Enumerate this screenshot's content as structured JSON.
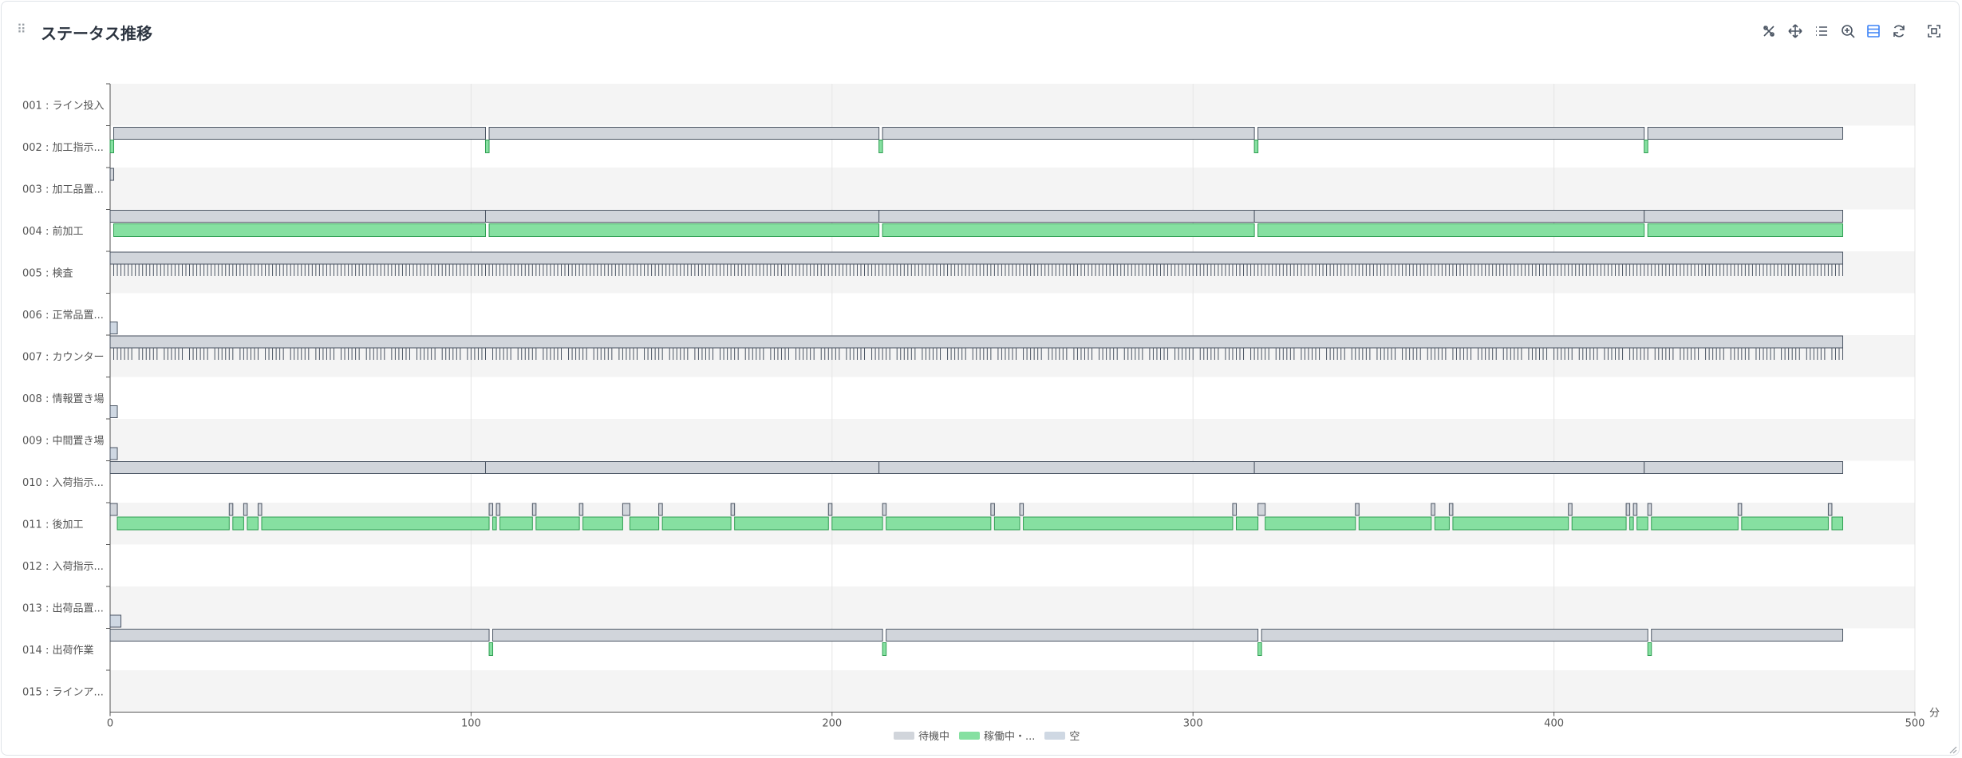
{
  "panel": {
    "title": "ステータス推移"
  },
  "toolbar": [
    "restore-icon",
    "pan-icon",
    "list-icon",
    "zoom-in-icon",
    "table-view-icon",
    "refresh-icon",
    "fullscreen-icon"
  ],
  "colors": {
    "waiting": "#d1d5db",
    "running": "#86e0a1",
    "empty": "#cfd8e3",
    "border": "#4b5563",
    "accent": "#3b82f6"
  },
  "legend": [
    {
      "key": "waiting",
      "label": "待機中"
    },
    {
      "key": "running",
      "label": "稼働中・..."
    },
    {
      "key": "empty",
      "label": "空"
    }
  ],
  "chart_data": {
    "type": "timeline",
    "xlabel": "分",
    "xlim": [
      0,
      500
    ],
    "xticks": [
      0,
      100,
      200,
      300,
      400,
      500
    ],
    "grid": true,
    "legend_position": "bottom",
    "rows": [
      {
        "label": "001 : ライン投入",
        "segments": []
      },
      {
        "label": "002 : 加工指示...",
        "segments": [
          [
            "waiting",
            1,
            104
          ],
          [
            "waiting",
            105,
            213
          ],
          [
            "waiting",
            214,
            317
          ],
          [
            "waiting",
            318,
            425
          ],
          [
            "waiting",
            426,
            480
          ],
          [
            "running",
            0,
            1
          ],
          [
            "running",
            104,
            105
          ],
          [
            "running",
            213,
            214
          ],
          [
            "running",
            317,
            318
          ],
          [
            "running",
            425,
            426
          ]
        ]
      },
      {
        "label": "003 : 加工品置...",
        "segments": [
          [
            "waiting",
            0,
            1
          ]
        ]
      },
      {
        "label": "004 : 前加工",
        "segments": [
          [
            "waiting",
            0,
            104
          ],
          [
            "waiting",
            104,
            213
          ],
          [
            "waiting",
            213,
            317
          ],
          [
            "waiting",
            317,
            425
          ],
          [
            "waiting",
            425,
            480
          ],
          [
            "running",
            1,
            104
          ],
          [
            "running",
            105,
            213
          ],
          [
            "running",
            214,
            317
          ],
          [
            "running",
            318,
            425
          ],
          [
            "running",
            426,
            480
          ]
        ]
      },
      {
        "label": "005 : 検査",
        "segments": [
          [
            "waiting",
            0,
            480
          ]
        ],
        "dense_ticks": "waiting-short",
        "tick_span": [
          1,
          480
        ]
      },
      {
        "label": "006 : 正常品置...",
        "segments": [
          [
            "empty",
            0,
            2
          ]
        ]
      },
      {
        "label": "007 : カウンター",
        "segments": [
          [
            "waiting",
            0,
            480
          ]
        ],
        "dense_ticks": "counter-short",
        "tick_span": [
          1,
          480
        ]
      },
      {
        "label": "008 : 情報置き場",
        "segments": [
          [
            "empty",
            0,
            2
          ]
        ]
      },
      {
        "label": "009 : 中間置き場",
        "segments": [
          [
            "empty",
            0,
            2
          ]
        ]
      },
      {
        "label": "010 : 入荷指示...",
        "segments": [
          [
            "waiting",
            0,
            104
          ],
          [
            "waiting",
            104,
            213
          ],
          [
            "waiting",
            213,
            317
          ],
          [
            "waiting",
            317,
            425
          ],
          [
            "waiting",
            425,
            480
          ]
        ]
      },
      {
        "label": "011 : 後加工",
        "segments": [
          [
            "waiting",
            0,
            2
          ],
          [
            "running",
            2,
            33
          ],
          [
            "waiting",
            33,
            34
          ],
          [
            "running",
            34,
            37
          ],
          [
            "waiting",
            37,
            38
          ],
          [
            "running",
            38,
            41
          ],
          [
            "waiting",
            41,
            42
          ],
          [
            "running",
            42,
            105
          ],
          [
            "waiting",
            105,
            106
          ],
          [
            "running",
            106,
            107
          ],
          [
            "waiting",
            107,
            108
          ],
          [
            "running",
            108,
            117
          ],
          [
            "waiting",
            117,
            118
          ],
          [
            "running",
            118,
            130
          ],
          [
            "waiting",
            130,
            131
          ],
          [
            "running",
            131,
            142
          ],
          [
            "waiting",
            142,
            144
          ],
          [
            "running",
            144,
            152
          ],
          [
            "waiting",
            152,
            153
          ],
          [
            "running",
            153,
            172
          ],
          [
            "waiting",
            172,
            173
          ],
          [
            "running",
            173,
            199
          ],
          [
            "waiting",
            199,
            200
          ],
          [
            "running",
            200,
            214
          ],
          [
            "waiting",
            214,
            215
          ],
          [
            "running",
            215,
            244
          ],
          [
            "waiting",
            244,
            245
          ],
          [
            "running",
            245,
            252
          ],
          [
            "waiting",
            252,
            253
          ],
          [
            "running",
            253,
            311
          ],
          [
            "waiting",
            311,
            312
          ],
          [
            "running",
            312,
            318
          ],
          [
            "waiting",
            318,
            320
          ],
          [
            "running",
            320,
            345
          ],
          [
            "waiting",
            345,
            346
          ],
          [
            "running",
            346,
            366
          ],
          [
            "waiting",
            366,
            367
          ],
          [
            "running",
            367,
            371
          ],
          [
            "waiting",
            371,
            372
          ],
          [
            "running",
            372,
            404
          ],
          [
            "waiting",
            404,
            405
          ],
          [
            "running",
            405,
            420
          ],
          [
            "waiting",
            420,
            421
          ],
          [
            "running",
            421,
            422
          ],
          [
            "waiting",
            422,
            423
          ],
          [
            "running",
            423,
            426
          ],
          [
            "waiting",
            426,
            427
          ],
          [
            "running",
            427,
            451
          ],
          [
            "waiting",
            451,
            452
          ],
          [
            "running",
            452,
            476
          ],
          [
            "waiting",
            476,
            477
          ],
          [
            "running",
            477,
            480
          ]
        ]
      },
      {
        "label": "012 : 入荷指示...",
        "segments": []
      },
      {
        "label": "013 : 出荷品置...",
        "segments": [
          [
            "empty",
            0,
            3
          ]
        ]
      },
      {
        "label": "014 : 出荷作業",
        "segments": [
          [
            "waiting",
            0,
            105
          ],
          [
            "waiting",
            106,
            214
          ],
          [
            "waiting",
            215,
            318
          ],
          [
            "waiting",
            319,
            426
          ],
          [
            "waiting",
            427,
            480
          ],
          [
            "running",
            105,
            106
          ],
          [
            "running",
            214,
            215
          ],
          [
            "running",
            318,
            319
          ],
          [
            "running",
            426,
            427
          ]
        ]
      },
      {
        "label": "015 : ラインア...",
        "segments": []
      }
    ]
  }
}
